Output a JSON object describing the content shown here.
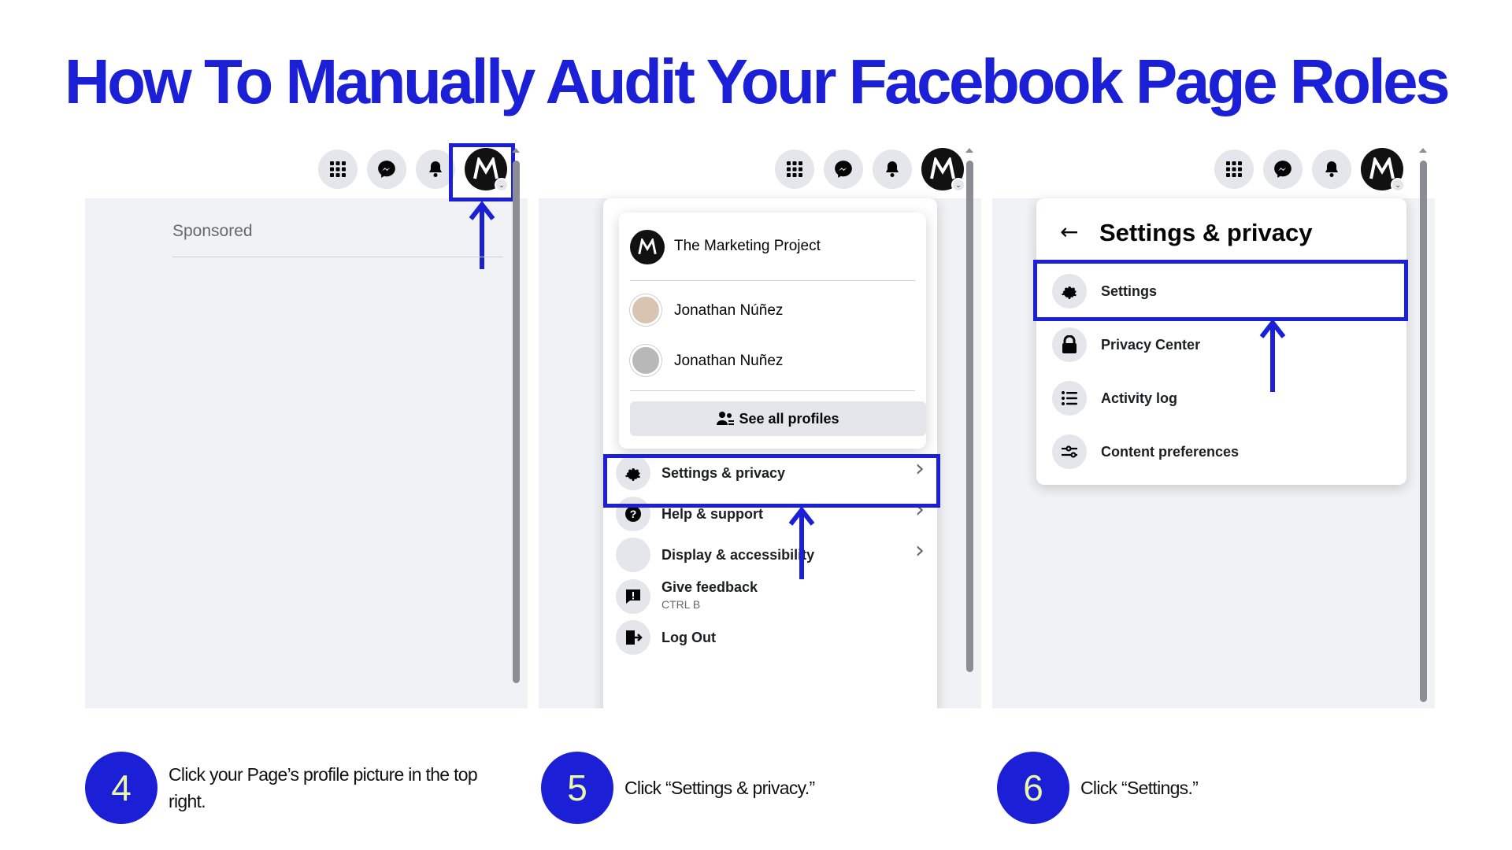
{
  "title": "How To Manually Audit Your Facebook Page Roles",
  "colors": {
    "accent": "#1b1fd6",
    "step_number": "#eaf7a6",
    "feed_bg": "#f0f2f5"
  },
  "panel1": {
    "icons": [
      "menu-grid-icon",
      "messenger-icon",
      "bell-icon",
      "page-avatar-icon"
    ],
    "sponsored": "Sponsored"
  },
  "panel2": {
    "profile_name": "The Marketing Project",
    "profiles": [
      "Jonathan Núñez",
      "Jonathan Nuñez"
    ],
    "see_all": "See all profiles",
    "menu": [
      {
        "label": "Settings & privacy",
        "icon": "gear-icon"
      },
      {
        "label": "Help & support",
        "icon": "question-icon"
      },
      {
        "label": "Display & accessibility",
        "icon": "moon-icon"
      },
      {
        "label": "Give feedback",
        "sub": "CTRL B",
        "icon": "feedback-icon"
      },
      {
        "label": "Log Out",
        "icon": "logout-icon"
      }
    ]
  },
  "panel3": {
    "back_title": "Settings & privacy",
    "items": [
      {
        "label": "Settings",
        "icon": "gear-icon"
      },
      {
        "label": "Privacy Center",
        "icon": "lock-icon"
      },
      {
        "label": "Activity log",
        "icon": "list-icon"
      },
      {
        "label": "Content preferences",
        "icon": "sliders-icon"
      }
    ]
  },
  "steps": [
    {
      "number": "4",
      "text": "Click your Page’s profile picture in the top right."
    },
    {
      "number": "5",
      "text": "Click “Settings & privacy.”"
    },
    {
      "number": "6",
      "text": "Click “Settings.”"
    }
  ]
}
